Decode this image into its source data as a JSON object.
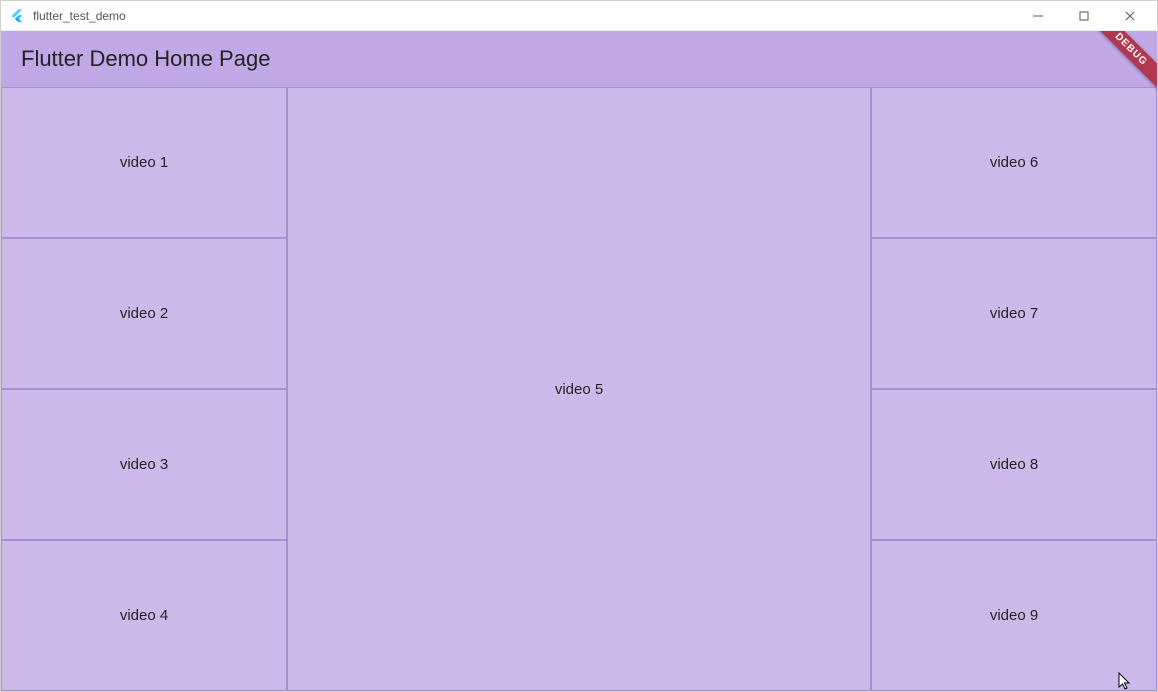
{
  "window": {
    "title": "flutter_test_demo"
  },
  "appbar": {
    "title": "Flutter Demo Home Page"
  },
  "debug_label": "DEBUG",
  "videos": {
    "left": [
      "video 1",
      "video 2",
      "video 3",
      "video 4"
    ],
    "center": "video 5",
    "right": [
      "video 6",
      "video 7",
      "video 8",
      "video 9"
    ]
  }
}
